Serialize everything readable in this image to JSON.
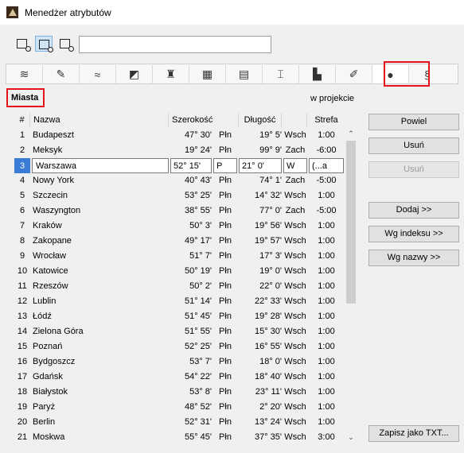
{
  "window": {
    "title": "Menedżer atrybutów"
  },
  "search": {
    "value": "",
    "placeholder": ""
  },
  "section": {
    "label": "Miasta",
    "subtitle": "w projekcie"
  },
  "tabs": [
    "layers-icon",
    "pen-icon",
    "line-type-icon",
    "fill-icon",
    "paint-bucket-icon",
    "composite-icon",
    "zone-icon",
    "profile-icon",
    "building-material-icon",
    "surface-icon",
    "location-globe-icon",
    "markup-icon"
  ],
  "table": {
    "headers": {
      "num": "#",
      "name": "Nazwa",
      "lat": "Szerokość",
      "lon": "Długość",
      "tz": "Strefa"
    },
    "selected": {
      "num": "3",
      "name": "Warszawa",
      "lat": "52° 15'",
      "ns": "P",
      "lon": "21° 0'",
      "ew": "W",
      "tz": "(...a"
    },
    "rows": [
      {
        "num": "1",
        "name": "Budapeszt",
        "lat": "47° 30'",
        "ns": "Płn",
        "lon": "19° 5'",
        "ew": "Wsch",
        "tz": "1:00"
      },
      {
        "num": "2",
        "name": "Meksyk",
        "lat": "19° 24'",
        "ns": "Płn",
        "lon": "99° 9'",
        "ew": "Zach",
        "tz": "-6:00"
      },
      {
        "num": "4",
        "name": "Nowy York",
        "lat": "40° 43'",
        "ns": "Płn",
        "lon": "74° 1'",
        "ew": "Zach",
        "tz": "-5:00"
      },
      {
        "num": "5",
        "name": "Szczecin",
        "lat": "53° 25'",
        "ns": "Płn",
        "lon": "14° 32'",
        "ew": "Wsch",
        "tz": "1:00"
      },
      {
        "num": "6",
        "name": "Waszyngton",
        "lat": "38° 55'",
        "ns": "Płn",
        "lon": "77° 0'",
        "ew": "Zach",
        "tz": "-5:00"
      },
      {
        "num": "7",
        "name": "Kraków",
        "lat": "50° 3'",
        "ns": "Płn",
        "lon": "19° 56'",
        "ew": "Wsch",
        "tz": "1:00"
      },
      {
        "num": "8",
        "name": "Zakopane",
        "lat": "49° 17'",
        "ns": "Płn",
        "lon": "19° 57'",
        "ew": "Wsch",
        "tz": "1:00"
      },
      {
        "num": "9",
        "name": "Wrocław",
        "lat": "51° 7'",
        "ns": "Płn",
        "lon": "17° 3'",
        "ew": "Wsch",
        "tz": "1:00"
      },
      {
        "num": "10",
        "name": "Katowice",
        "lat": "50° 19'",
        "ns": "Płn",
        "lon": "19° 0'",
        "ew": "Wsch",
        "tz": "1:00"
      },
      {
        "num": "11",
        "name": "Rzeszów",
        "lat": "50° 2'",
        "ns": "Płn",
        "lon": "22° 0'",
        "ew": "Wsch",
        "tz": "1:00"
      },
      {
        "num": "12",
        "name": "Lublin",
        "lat": "51° 14'",
        "ns": "Płn",
        "lon": "22° 33'",
        "ew": "Wsch",
        "tz": "1:00"
      },
      {
        "num": "13",
        "name": "Łódź",
        "lat": "51° 45'",
        "ns": "Płn",
        "lon": "19° 28'",
        "ew": "Wsch",
        "tz": "1:00"
      },
      {
        "num": "14",
        "name": "Zielona Góra",
        "lat": "51° 55'",
        "ns": "Płn",
        "lon": "15° 30'",
        "ew": "Wsch",
        "tz": "1:00"
      },
      {
        "num": "15",
        "name": "Poznań",
        "lat": "52° 25'",
        "ns": "Płn",
        "lon": "16° 55'",
        "ew": "Wsch",
        "tz": "1:00"
      },
      {
        "num": "16",
        "name": "Bydgoszcz",
        "lat": "53° 7'",
        "ns": "Płn",
        "lon": "18° 0'",
        "ew": "Wsch",
        "tz": "1:00"
      },
      {
        "num": "17",
        "name": "Gdańsk",
        "lat": "54° 22'",
        "ns": "Płn",
        "lon": "18° 40'",
        "ew": "Wsch",
        "tz": "1:00"
      },
      {
        "num": "18",
        "name": "Białystok",
        "lat": "53° 8'",
        "ns": "Płn",
        "lon": "23° 11'",
        "ew": "Wsch",
        "tz": "1:00"
      },
      {
        "num": "19",
        "name": "Paryż",
        "lat": "48° 52'",
        "ns": "Płn",
        "lon": "2° 20'",
        "ew": "Wsch",
        "tz": "1:00"
      },
      {
        "num": "20",
        "name": "Berlin",
        "lat": "52° 31'",
        "ns": "Płn",
        "lon": "13° 24'",
        "ew": "Wsch",
        "tz": "1:00"
      },
      {
        "num": "21",
        "name": "Moskwa",
        "lat": "55° 45'",
        "ns": "Płn",
        "lon": "37° 35'",
        "ew": "Wsch",
        "tz": "3:00"
      }
    ]
  },
  "buttons": {
    "powiel": "Powiel",
    "usun": "Usuń",
    "usun2": "Usuń",
    "dodaj": "Dodaj >>",
    "wg_indeksu": "Wg indeksu >>",
    "wg_nazwy": "Wg nazwy >>",
    "zapisz": "Zapisz jako TXT..."
  },
  "colors": {
    "highlight": "#e8131a",
    "selection": "#3a7bd5"
  }
}
